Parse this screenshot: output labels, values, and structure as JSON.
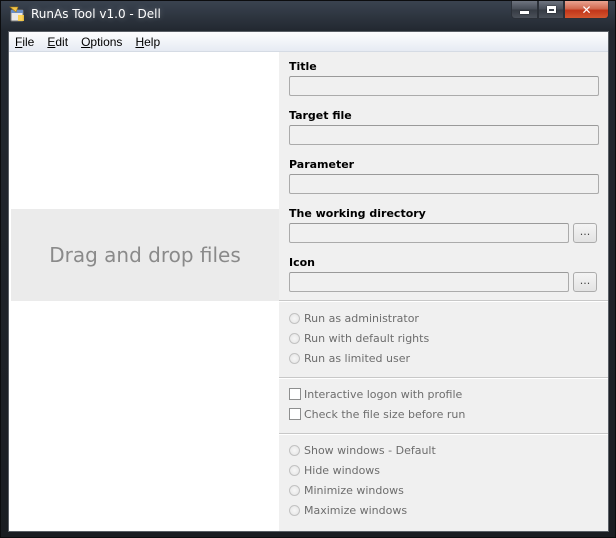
{
  "window": {
    "title": "RunAs Tool v1.0 - Dell"
  },
  "menu": {
    "file": {
      "accel": "F",
      "rest": "ile"
    },
    "edit": {
      "accel": "E",
      "rest": "dit"
    },
    "options": {
      "accel": "O",
      "rest": "ptions"
    },
    "help": {
      "accel": "H",
      "rest": "elp"
    }
  },
  "drop_zone": {
    "text": "Drag and drop files"
  },
  "form": {
    "title_label": "Title",
    "title_value": "",
    "target_label": "Target file",
    "target_value": "",
    "parameter_label": "Parameter",
    "parameter_value": "",
    "workdir_label": "The working directory",
    "workdir_value": "",
    "workdir_browse": "...",
    "icon_label": "Icon",
    "icon_value": "",
    "icon_browse": "..."
  },
  "rights_options": [
    {
      "label": "Run as administrator",
      "selected": false
    },
    {
      "label": "Run with default rights",
      "selected": false
    },
    {
      "label": "Run as limited user",
      "selected": false
    }
  ],
  "check_options": [
    {
      "label": "Interactive logon with profile",
      "checked": false
    },
    {
      "label": "Check the file size before run",
      "checked": false
    }
  ],
  "window_options": [
    {
      "label": "Show windows - Default",
      "selected": false
    },
    {
      "label": "Hide windows",
      "selected": false
    },
    {
      "label": "Minimize windows",
      "selected": false
    },
    {
      "label": "Maximize windows",
      "selected": false
    }
  ],
  "colors": {
    "accent_close": "#c2361a",
    "panel_bg": "#f0f0f0",
    "drop_bg": "#ebebeb"
  }
}
